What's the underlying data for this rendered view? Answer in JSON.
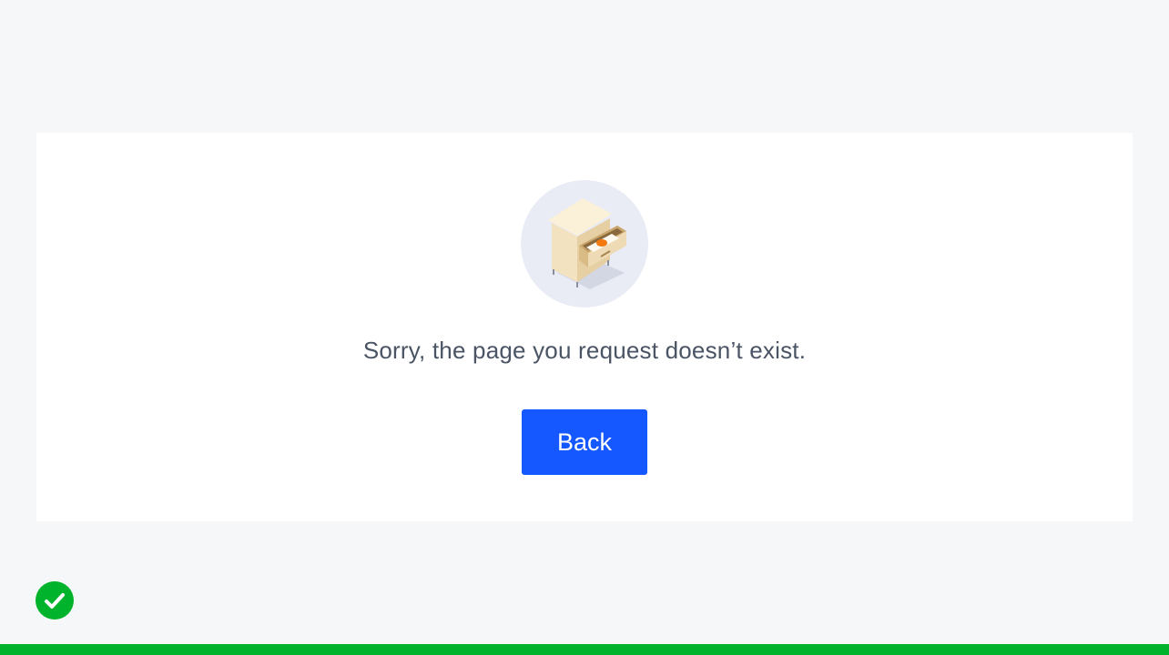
{
  "error": {
    "message": "Sorry, the page you request doesn’t exist.",
    "illustration_icon": "empty-drawer-cabinet-icon"
  },
  "actions": {
    "back_label": "Back"
  },
  "status": {
    "icon": "checkmark-icon"
  },
  "colors": {
    "page_background": "#f6f7f9",
    "card_background": "#ffffff",
    "primary_button": "#1658ff",
    "message_text": "#4a5464",
    "success_green": "#00b32c",
    "illustration_circle": "#e9ecf5"
  }
}
